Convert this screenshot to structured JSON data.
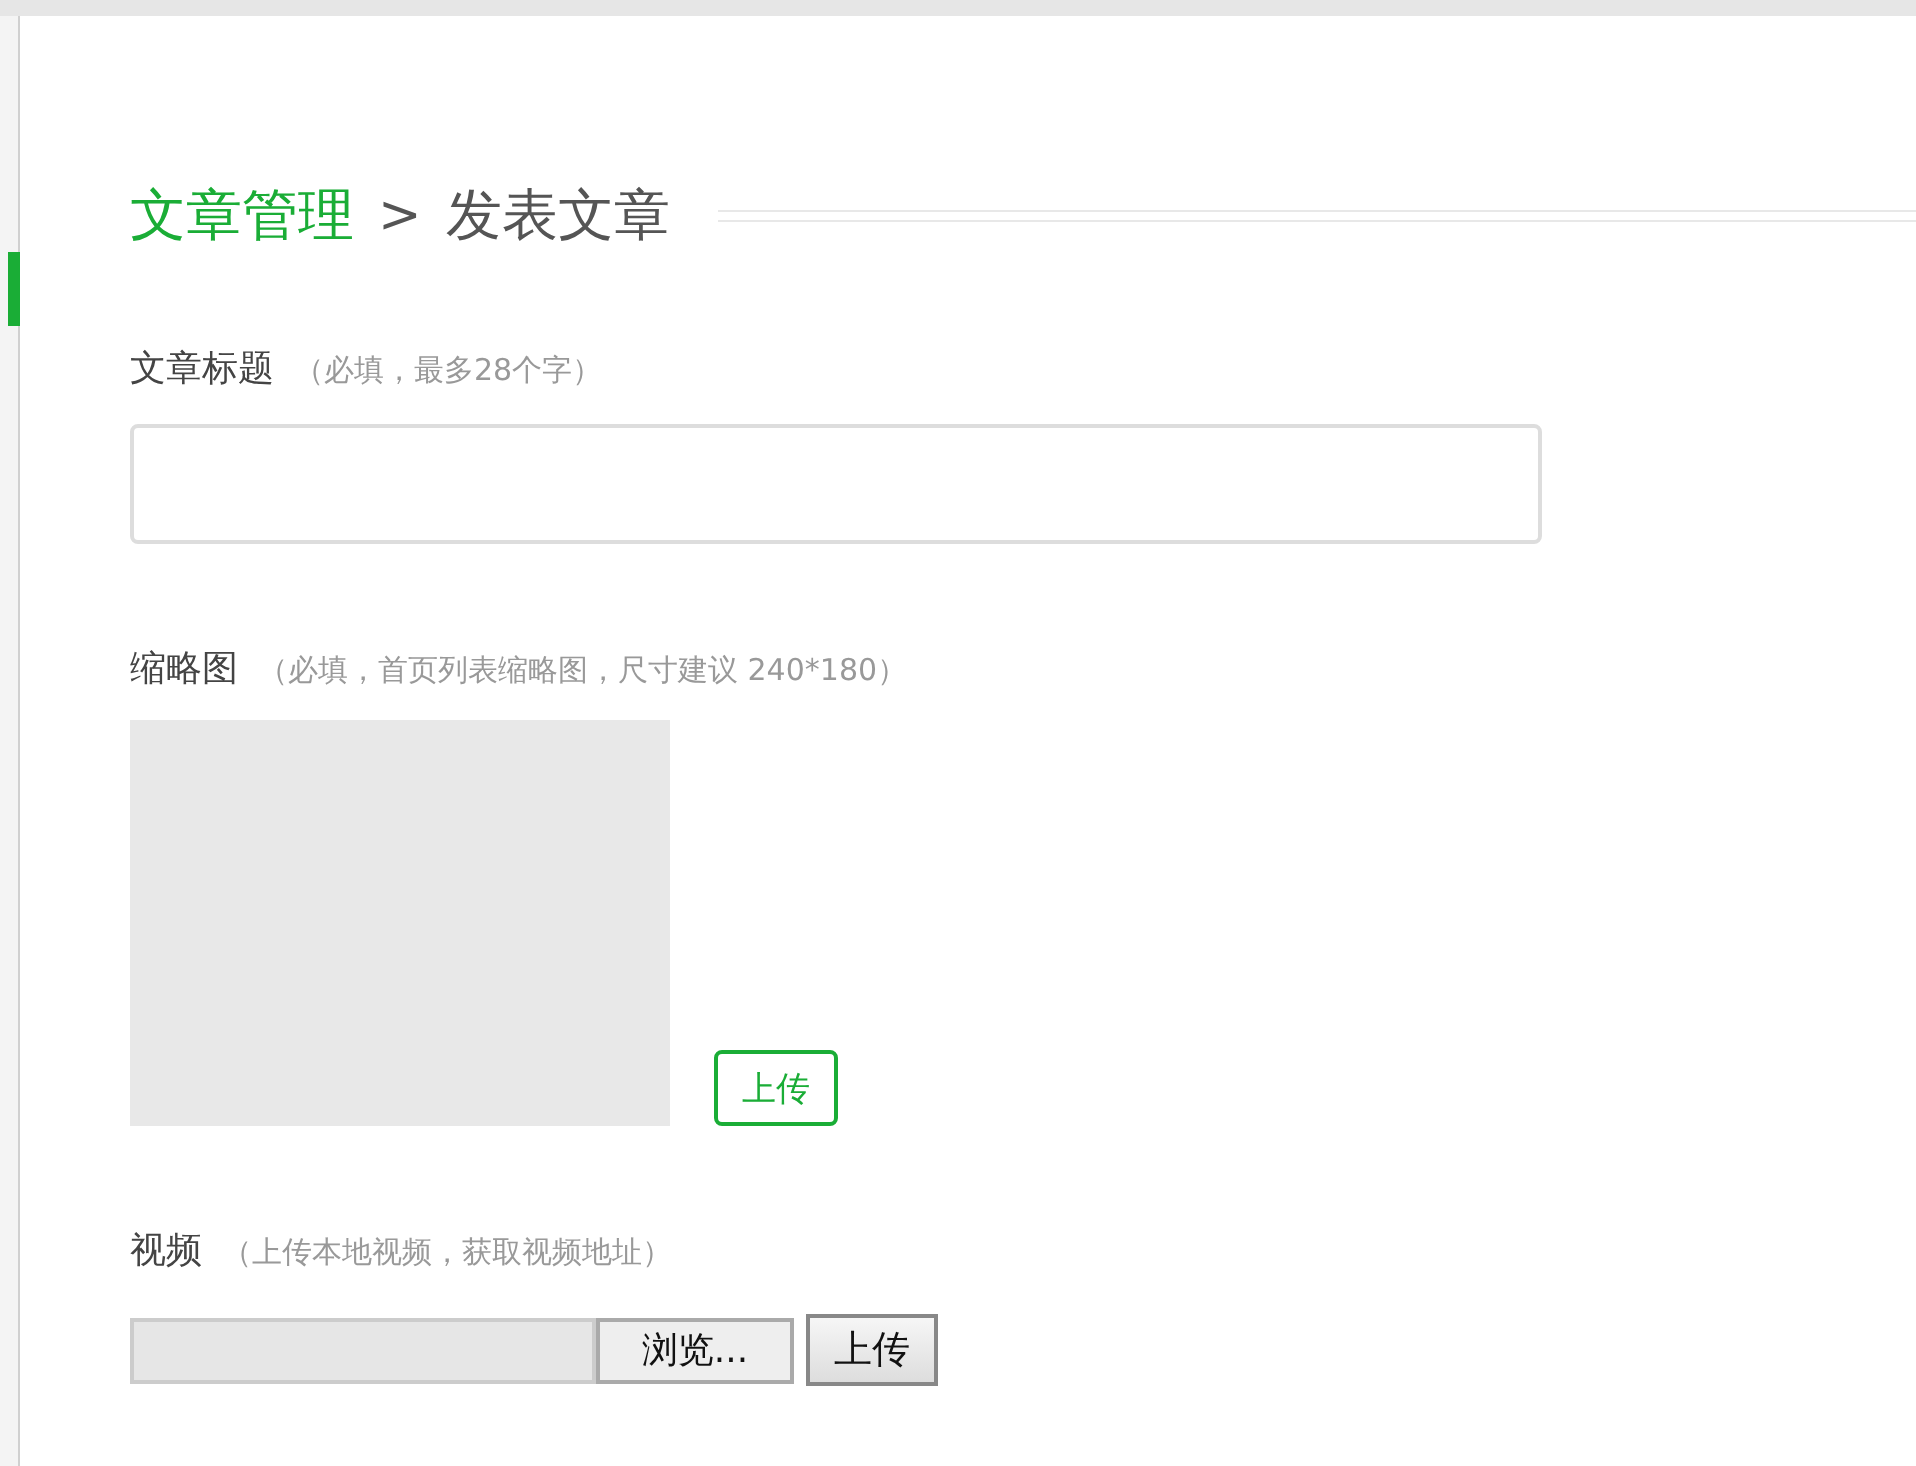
{
  "breadcrumb": {
    "parent": "文章管理",
    "separator": ">",
    "current": "发表文章"
  },
  "fields": [
    {
      "kind": "text",
      "label": "文章标题",
      "hint": "（必填，最多28个字）"
    },
    {
      "kind": "image",
      "label": "缩略图",
      "hint": "（必填，首页列表缩略图，尺寸建议 240*180）",
      "button": "上传"
    },
    {
      "kind": "file",
      "label": "视频",
      "hint": "（上传本地视频，获取视频地址）",
      "browse": "浏览...",
      "button": "上传"
    }
  ]
}
